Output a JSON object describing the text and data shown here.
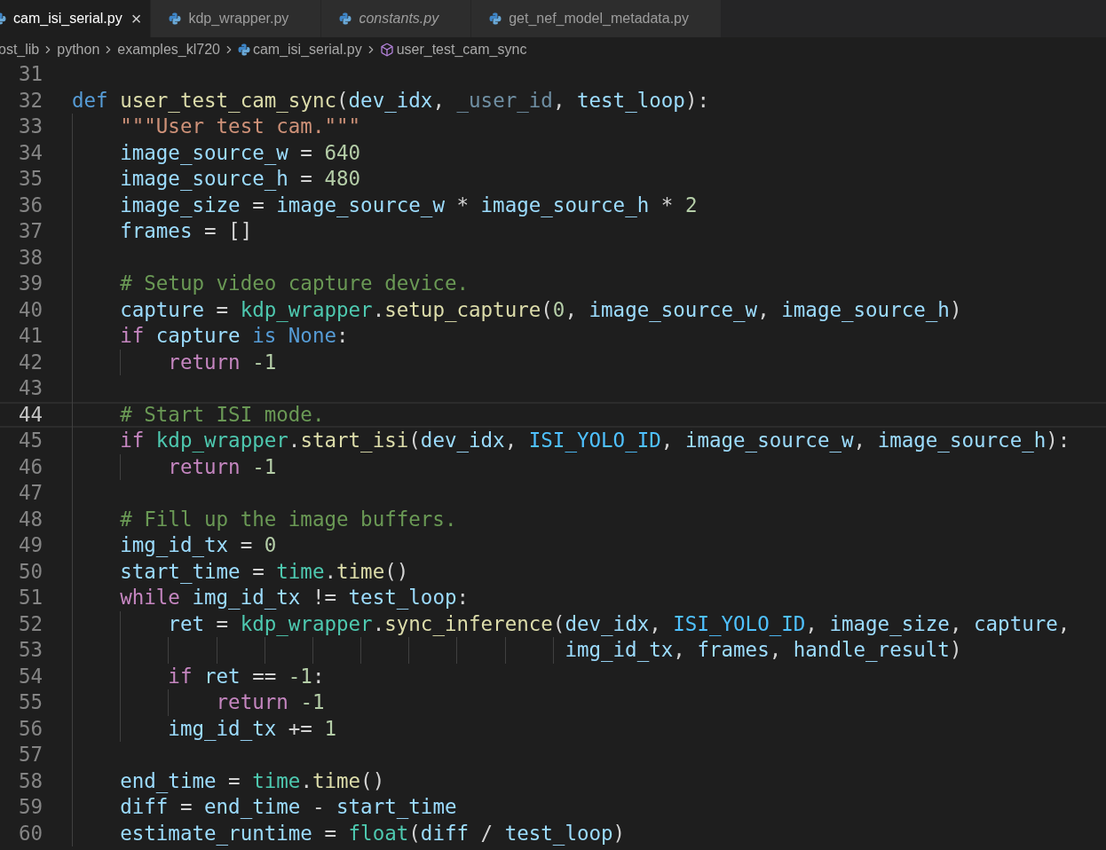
{
  "tabs": [
    {
      "label": "cam_isi_serial.py",
      "selected": true,
      "preview": false,
      "close": "×"
    },
    {
      "label": "kdp_wrapper.py",
      "selected": false,
      "preview": false
    },
    {
      "label": "constants.py",
      "selected": false,
      "preview": true
    },
    {
      "label": "get_nef_model_metadata.py",
      "selected": false,
      "preview": false
    }
  ],
  "breadcrumbs": [
    {
      "label": "ost_lib",
      "kind": "folder"
    },
    {
      "label": "python",
      "kind": "folder"
    },
    {
      "label": "examples_kl720",
      "kind": "folder"
    },
    {
      "label": "cam_isi_serial.py",
      "kind": "file"
    },
    {
      "label": "user_test_cam_sync",
      "kind": "symbol"
    }
  ],
  "lines": [
    {
      "number": "31",
      "kind": "blank",
      "current": false
    },
    {
      "number": "32",
      "kind": "code",
      "current": false,
      "tokens": [
        {
          "text": "def ",
          "kind": "kw"
        },
        {
          "text": "user_test_cam_sync",
          "kind": "fn"
        },
        {
          "text": "(",
          "kind": "plain"
        },
        {
          "text": "dev_idx",
          "kind": "var"
        },
        {
          "text": ", ",
          "kind": "plain"
        },
        {
          "text": "_user_id",
          "kind": "unused"
        },
        {
          "text": ", ",
          "kind": "plain"
        },
        {
          "text": "test_loop",
          "kind": "var"
        },
        {
          "text": "):",
          "kind": "plain"
        }
      ],
      "children": [
        {
          "number": "33",
          "kind": "code",
          "current": false,
          "tokens": [
            {
              "text": "\"\"\"User test cam.\"\"\"",
              "kind": "str"
            }
          ]
        },
        {
          "number": "34",
          "kind": "code",
          "current": false,
          "tokens": [
            {
              "text": "image_source_w",
              "kind": "var"
            },
            {
              "text": " = ",
              "kind": "plain"
            },
            {
              "text": "640",
              "kind": "num"
            }
          ]
        },
        {
          "number": "35",
          "kind": "code",
          "current": false,
          "tokens": [
            {
              "text": "image_source_h",
              "kind": "var"
            },
            {
              "text": " = ",
              "kind": "plain"
            },
            {
              "text": "480",
              "kind": "num"
            }
          ]
        },
        {
          "number": "36",
          "kind": "code",
          "current": false,
          "tokens": [
            {
              "text": "image_size",
              "kind": "var"
            },
            {
              "text": " = ",
              "kind": "plain"
            },
            {
              "text": "image_source_w",
              "kind": "var"
            },
            {
              "text": " * ",
              "kind": "plain"
            },
            {
              "text": "image_source_h",
              "kind": "var"
            },
            {
              "text": " * ",
              "kind": "plain"
            },
            {
              "text": "2",
              "kind": "num"
            }
          ]
        },
        {
          "number": "37",
          "kind": "code",
          "current": false,
          "tokens": [
            {
              "text": "frames",
              "kind": "var"
            },
            {
              "text": " = []",
              "kind": "plain"
            }
          ]
        },
        {
          "number": "38",
          "kind": "blank",
          "current": false
        },
        {
          "number": "39",
          "kind": "code",
          "current": false,
          "tokens": [
            {
              "text": "# Setup video capture device.",
              "kind": "com"
            }
          ]
        },
        {
          "number": "40",
          "kind": "code",
          "current": false,
          "tokens": [
            {
              "text": "capture",
              "kind": "var"
            },
            {
              "text": " = ",
              "kind": "plain"
            },
            {
              "text": "kdp_wrapper",
              "kind": "cls"
            },
            {
              "text": ".",
              "kind": "plain"
            },
            {
              "text": "setup_capture",
              "kind": "fn"
            },
            {
              "text": "(",
              "kind": "plain"
            },
            {
              "text": "0",
              "kind": "num"
            },
            {
              "text": ", ",
              "kind": "plain"
            },
            {
              "text": "image_source_w",
              "kind": "var"
            },
            {
              "text": ", ",
              "kind": "plain"
            },
            {
              "text": "image_source_h",
              "kind": "var"
            },
            {
              "text": ")",
              "kind": "plain"
            }
          ]
        },
        {
          "number": "41",
          "kind": "code",
          "current": false,
          "tokens": [
            {
              "text": "if ",
              "kind": "ctrl"
            },
            {
              "text": "capture ",
              "kind": "var"
            },
            {
              "text": "is ",
              "kind": "kw"
            },
            {
              "text": "None",
              "kind": "kw"
            },
            {
              "text": ":",
              "kind": "plain"
            }
          ],
          "children": [
            {
              "number": "42",
              "kind": "code",
              "current": false,
              "tokens": [
                {
                  "text": "return ",
                  "kind": "ctrl"
                },
                {
                  "text": "-1",
                  "kind": "num"
                }
              ]
            }
          ]
        },
        {
          "number": "43",
          "kind": "blank",
          "current": false
        },
        {
          "number": "44",
          "kind": "code",
          "current": true,
          "tokens": [
            {
              "text": "# Start ISI mode.",
              "kind": "com"
            }
          ]
        },
        {
          "number": "45",
          "kind": "code",
          "current": false,
          "tokens": [
            {
              "text": "if ",
              "kind": "ctrl"
            },
            {
              "text": "kdp_wrapper",
              "kind": "cls"
            },
            {
              "text": ".",
              "kind": "plain"
            },
            {
              "text": "start_isi",
              "kind": "fn"
            },
            {
              "text": "(",
              "kind": "plain"
            },
            {
              "text": "dev_idx",
              "kind": "var"
            },
            {
              "text": ", ",
              "kind": "plain"
            },
            {
              "text": "ISI_YOLO_ID",
              "kind": "const"
            },
            {
              "text": ", ",
              "kind": "plain"
            },
            {
              "text": "image_source_w",
              "kind": "var"
            },
            {
              "text": ", ",
              "kind": "plain"
            },
            {
              "text": "image_source_h",
              "kind": "var"
            },
            {
              "text": "):",
              "kind": "plain"
            }
          ],
          "children": [
            {
              "number": "46",
              "kind": "code",
              "current": false,
              "tokens": [
                {
                  "text": "return ",
                  "kind": "ctrl"
                },
                {
                  "text": "-1",
                  "kind": "num"
                }
              ]
            }
          ]
        },
        {
          "number": "47",
          "kind": "blank",
          "current": false
        },
        {
          "number": "48",
          "kind": "code",
          "current": false,
          "tokens": [
            {
              "text": "# Fill up the image buffers.",
              "kind": "com"
            }
          ]
        },
        {
          "number": "49",
          "kind": "code",
          "current": false,
          "tokens": [
            {
              "text": "img_id_tx",
              "kind": "var"
            },
            {
              "text": " = ",
              "kind": "plain"
            },
            {
              "text": "0",
              "kind": "num"
            }
          ]
        },
        {
          "number": "50",
          "kind": "code",
          "current": false,
          "tokens": [
            {
              "text": "start_time",
              "kind": "var"
            },
            {
              "text": " = ",
              "kind": "plain"
            },
            {
              "text": "time",
              "kind": "cls"
            },
            {
              "text": ".",
              "kind": "plain"
            },
            {
              "text": "time",
              "kind": "fn"
            },
            {
              "text": "()",
              "kind": "plain"
            }
          ]
        },
        {
          "number": "51",
          "kind": "code",
          "current": false,
          "tokens": [
            {
              "text": "while ",
              "kind": "ctrl"
            },
            {
              "text": "img_id_tx",
              "kind": "var"
            },
            {
              "text": " != ",
              "kind": "plain"
            },
            {
              "text": "test_loop",
              "kind": "var"
            },
            {
              "text": ":",
              "kind": "plain"
            }
          ],
          "children": [
            {
              "number": "52",
              "kind": "code",
              "current": false,
              "tokens": [
                {
                  "text": "ret",
                  "kind": "var"
                },
                {
                  "text": " = ",
                  "kind": "plain"
                },
                {
                  "text": "kdp_wrapper",
                  "kind": "cls"
                },
                {
                  "text": ".",
                  "kind": "plain"
                },
                {
                  "text": "sync_inference",
                  "kind": "fn"
                },
                {
                  "text": "(",
                  "kind": "plain"
                },
                {
                  "text": "dev_idx",
                  "kind": "var"
                },
                {
                  "text": ", ",
                  "kind": "plain"
                },
                {
                  "text": "ISI_YOLO_ID",
                  "kind": "const"
                },
                {
                  "text": ", ",
                  "kind": "plain"
                },
                {
                  "text": "image_size",
                  "kind": "var"
                },
                {
                  "text": ", ",
                  "kind": "plain"
                },
                {
                  "text": "capture",
                  "kind": "var"
                },
                {
                  "text": ",",
                  "kind": "plain"
                }
              ]
            },
            {
              "number": "53",
              "kind": "continuation",
              "current": false,
              "tokens": [
                {
                  "text": "img_id_tx",
                  "kind": "var"
                },
                {
                  "text": ", ",
                  "kind": "plain"
                },
                {
                  "text": "frames",
                  "kind": "var"
                },
                {
                  "text": ", ",
                  "kind": "plain"
                },
                {
                  "text": "handle_result",
                  "kind": "var"
                },
                {
                  "text": ")",
                  "kind": "plain"
                }
              ]
            },
            {
              "number": "54",
              "kind": "code",
              "current": false,
              "tokens": [
                {
                  "text": "if ",
                  "kind": "ctrl"
                },
                {
                  "text": "ret",
                  "kind": "var"
                },
                {
                  "text": " == ",
                  "kind": "plain"
                },
                {
                  "text": "-1",
                  "kind": "num"
                },
                {
                  "text": ":",
                  "kind": "plain"
                }
              ],
              "children": [
                {
                  "number": "55",
                  "kind": "code",
                  "current": false,
                  "tokens": [
                    {
                      "text": "return ",
                      "kind": "ctrl"
                    },
                    {
                      "text": "-1",
                      "kind": "num"
                    }
                  ]
                }
              ]
            },
            {
              "number": "56",
              "kind": "code",
              "current": false,
              "tokens": [
                {
                  "text": "img_id_tx",
                  "kind": "var"
                },
                {
                  "text": " += ",
                  "kind": "plain"
                },
                {
                  "text": "1",
                  "kind": "num"
                }
              ]
            }
          ]
        },
        {
          "number": "57",
          "kind": "blank",
          "current": false
        },
        {
          "number": "58",
          "kind": "code",
          "current": false,
          "tokens": [
            {
              "text": "end_time",
              "kind": "var"
            },
            {
              "text": " = ",
              "kind": "plain"
            },
            {
              "text": "time",
              "kind": "cls"
            },
            {
              "text": ".",
              "kind": "plain"
            },
            {
              "text": "time",
              "kind": "fn"
            },
            {
              "text": "()",
              "kind": "plain"
            }
          ]
        },
        {
          "number": "59",
          "kind": "code",
          "current": false,
          "tokens": [
            {
              "text": "diff",
              "kind": "var"
            },
            {
              "text": " = ",
              "kind": "plain"
            },
            {
              "text": "end_time",
              "kind": "var"
            },
            {
              "text": " - ",
              "kind": "plain"
            },
            {
              "text": "start_time",
              "kind": "var"
            }
          ]
        },
        {
          "number": "60",
          "kind": "code",
          "current": false,
          "tokens": [
            {
              "text": "estimate_runtime",
              "kind": "var"
            },
            {
              "text": " = ",
              "kind": "plain"
            },
            {
              "text": "float",
              "kind": "cls"
            },
            {
              "text": "(",
              "kind": "plain"
            },
            {
              "text": "diff",
              "kind": "var"
            },
            {
              "text": " / ",
              "kind": "plain"
            },
            {
              "text": "test_loop",
              "kind": "var"
            },
            {
              "text": ")",
              "kind": "plain"
            }
          ]
        }
      ]
    }
  ]
}
